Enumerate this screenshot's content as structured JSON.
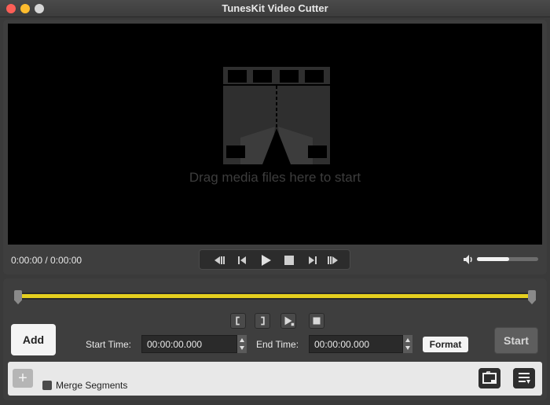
{
  "window": {
    "title": "TunesKit Video Cutter"
  },
  "player": {
    "placeholder": "Drag media files here to start",
    "time": "0:00:00 / 0:00:00",
    "volume_level": 0.52
  },
  "editor": {
    "add_label": "Add",
    "start_time_label": "Start Time:",
    "start_time_value": "00:00:00.000",
    "end_time_label": "End Time:",
    "end_time_value": "00:00:00.000",
    "format_label": "Format",
    "start_label": "Start"
  },
  "bottom": {
    "plus_label": "+",
    "merge_label": "Merge Segments"
  },
  "colors": {
    "accent": "#e5cf1f",
    "background": "#3a3a3a",
    "screen": "#000000"
  },
  "icons": [
    "film-icon",
    "prev-icon",
    "step-back-icon",
    "play-icon",
    "stop-icon",
    "step-forward-icon",
    "next-icon",
    "volume-icon",
    "mark-in-icon",
    "mark-out-icon",
    "play-segment-icon",
    "stop-segment-icon",
    "output-folder-icon",
    "list-icon"
  ]
}
